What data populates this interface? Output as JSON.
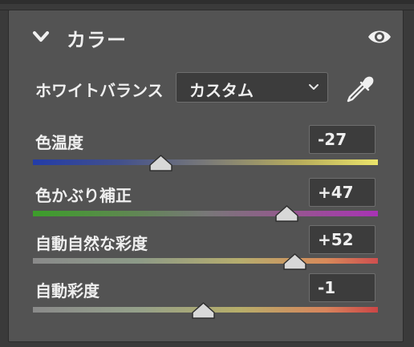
{
  "panel": {
    "title": "カラー",
    "expanded": true
  },
  "white_balance": {
    "label": "ホワイトバランス",
    "selected": "カスタム"
  },
  "sliders": [
    {
      "label": "色温度",
      "value": "-27",
      "position": 0.37
    },
    {
      "label": "色かぶり補正",
      "value": "+47",
      "position": 0.735
    },
    {
      "label": "自動自然な彩度",
      "value": "+52",
      "position": 0.76
    },
    {
      "label": "自動彩度",
      "value": "-1",
      "position": 0.495
    }
  ],
  "icons": {
    "collapse": "chevron-down-icon",
    "visibility": "eye-icon",
    "picker": "eyedropper-icon",
    "dropdown": "chevron-down-icon"
  },
  "colors": {
    "panel_bg": "#535353",
    "field_bg": "#3c3c3c",
    "text": "#efefef",
    "thumb": "#d8d8d8"
  }
}
